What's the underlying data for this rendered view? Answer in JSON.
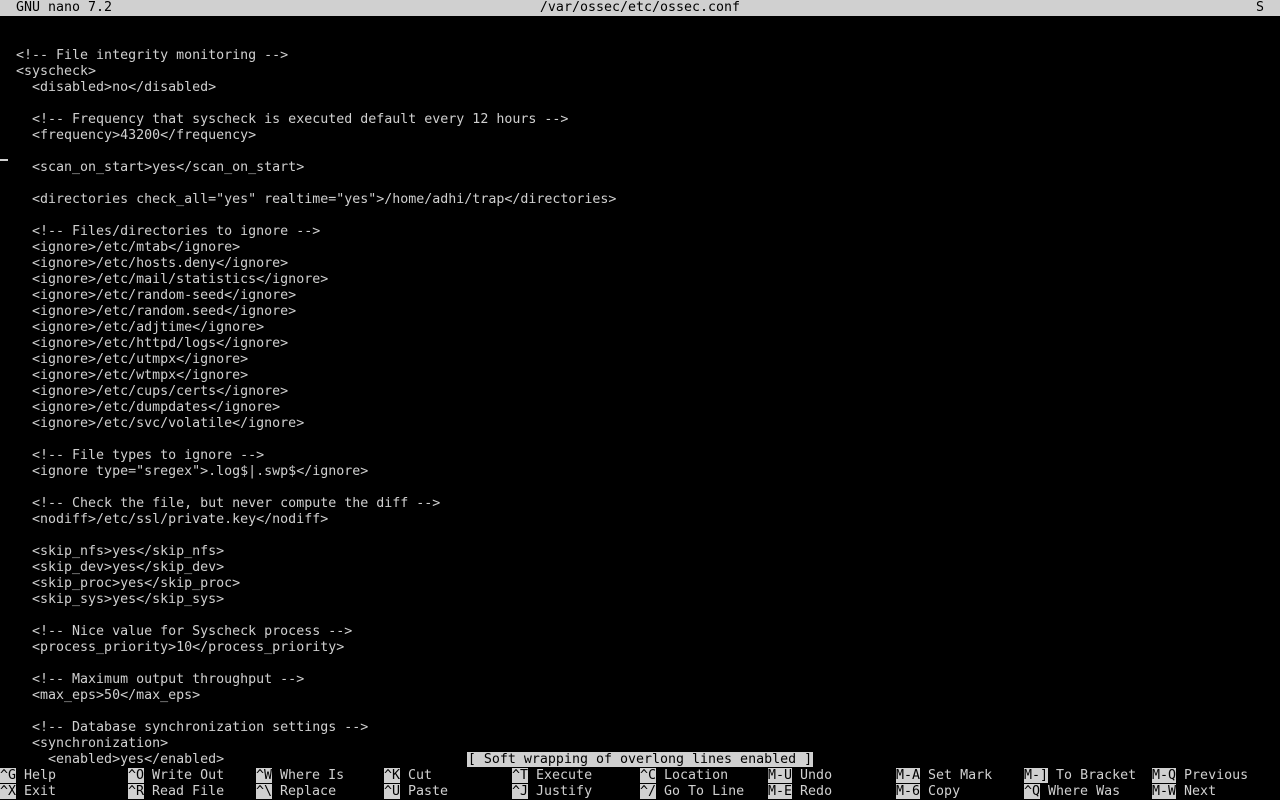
{
  "titlebar": {
    "app": "GNU nano 7.2",
    "filename": "/var/ossec/etc/ossec.conf",
    "state": "S"
  },
  "editor_lines": [
    "",
    "<!-- File integrity monitoring -->",
    "<syscheck>",
    "  <disabled>no</disabled>",
    "",
    "  <!-- Frequency that syscheck is executed default every 12 hours -->",
    "  <frequency>43200</frequency>",
    "",
    "  <scan_on_start>yes</scan_on_start>",
    "",
    "  <directories check_all=\"yes\" realtime=\"yes\">/home/adhi/trap</directories>",
    "",
    "  <!-- Files/directories to ignore -->",
    "  <ignore>/etc/mtab</ignore>",
    "  <ignore>/etc/hosts.deny</ignore>",
    "  <ignore>/etc/mail/statistics</ignore>",
    "  <ignore>/etc/random-seed</ignore>",
    "  <ignore>/etc/random.seed</ignore>",
    "  <ignore>/etc/adjtime</ignore>",
    "  <ignore>/etc/httpd/logs</ignore>",
    "  <ignore>/etc/utmpx</ignore>",
    "  <ignore>/etc/wtmpx</ignore>",
    "  <ignore>/etc/cups/certs</ignore>",
    "  <ignore>/etc/dumpdates</ignore>",
    "  <ignore>/etc/svc/volatile</ignore>",
    "",
    "  <!-- File types to ignore -->",
    "  <ignore type=\"sregex\">.log$|.swp$</ignore>",
    "",
    "  <!-- Check the file, but never compute the diff -->",
    "  <nodiff>/etc/ssl/private.key</nodiff>",
    "",
    "  <skip_nfs>yes</skip_nfs>",
    "  <skip_dev>yes</skip_dev>",
    "  <skip_proc>yes</skip_proc>",
    "  <skip_sys>yes</skip_sys>",
    "",
    "  <!-- Nice value for Syscheck process -->",
    "  <process_priority>10</process_priority>",
    "",
    "  <!-- Maximum output throughput -->",
    "  <max_eps>50</max_eps>",
    "",
    "  <!-- Database synchronization settings -->",
    "  <synchronization>",
    "    <enabled>yes</enabled>"
  ],
  "status_message": "[ Soft wrapping of overlong lines enabled ]",
  "shortcuts": [
    {
      "key": "^G",
      "label": "Help"
    },
    {
      "key": "^X",
      "label": "Exit"
    },
    {
      "key": "^O",
      "label": "Write Out"
    },
    {
      "key": "^R",
      "label": "Read File"
    },
    {
      "key": "^W",
      "label": "Where Is"
    },
    {
      "key": "^\\",
      "label": "Replace"
    },
    {
      "key": "^K",
      "label": "Cut"
    },
    {
      "key": "^U",
      "label": "Paste"
    },
    {
      "key": "^T",
      "label": "Execute"
    },
    {
      "key": "^J",
      "label": "Justify"
    },
    {
      "key": "^C",
      "label": "Location"
    },
    {
      "key": "^/",
      "label": "Go To Line"
    },
    {
      "key": "M-U",
      "label": "Undo"
    },
    {
      "key": "M-E",
      "label": "Redo"
    },
    {
      "key": "M-A",
      "label": "Set Mark"
    },
    {
      "key": "M-6",
      "label": "Copy"
    },
    {
      "key": "M-]",
      "label": "To Bracket"
    },
    {
      "key": "^Q",
      "label": "Where Was"
    },
    {
      "key": "M-Q",
      "label": "Previous"
    },
    {
      "key": "M-W",
      "label": "Next"
    }
  ],
  "colors": {
    "background": "#000000",
    "foreground": "#d0d0d0",
    "inverse_bg": "#d0d0d0",
    "inverse_fg": "#000000"
  }
}
